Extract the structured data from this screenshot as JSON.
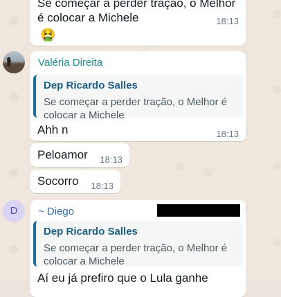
{
  "messages": {
    "m1": {
      "text": "Se começar a perder tração, o Melhor é colocar a Michele",
      "time": "18:13",
      "emoji": "🤮"
    },
    "m2": {
      "sender": "Valéria Direita",
      "sender_color": "#1f8f8b",
      "quote_author": "Dep Ricardo Salles",
      "quote_text": "Se começar a perder tração, o Melhor é colocar a Michele",
      "text": "Ahh n",
      "time": "18:13"
    },
    "m3": {
      "text": "Peloamor",
      "time": "18:13"
    },
    "m4": {
      "text": "Socorro",
      "time": "18:13"
    },
    "m5": {
      "avatar_initial": "D",
      "sender": "~ Diego",
      "sender_color": "#3a6bb5",
      "quote_author": "Dep Ricardo Salles",
      "quote_text": "Se começar a perder tração, o Melhor é colocar a Michele",
      "text": "Aí eu já prefiro que o Lula ganhe"
    }
  }
}
